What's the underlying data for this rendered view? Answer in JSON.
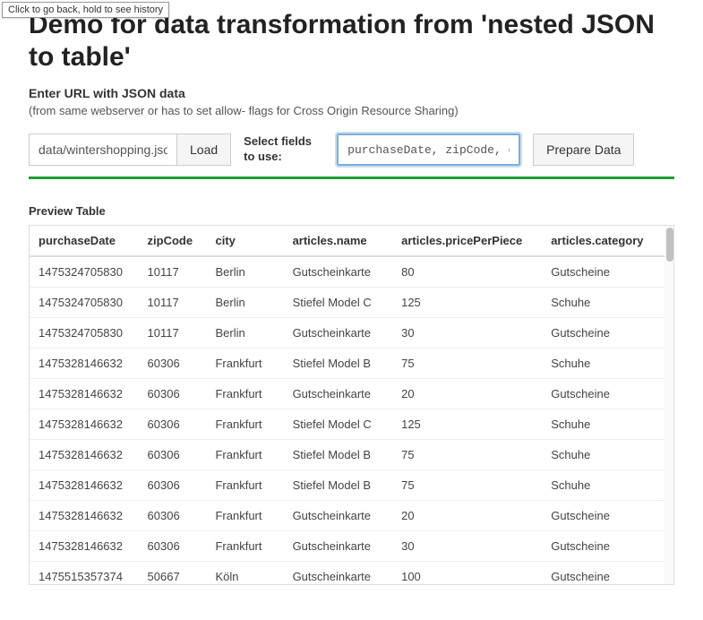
{
  "tooltip_text": "Click to go back, hold to see history",
  "page_title": "Demo for data transformation from 'nested JSON to table'",
  "url_section": {
    "label": "Enter URL with JSON data",
    "hint": "(from same webserver or has to set allow- flags for Cross Origin Resource Sharing)"
  },
  "controls": {
    "url_value": "data/wintershopping.json",
    "load_label": "Load",
    "select_fields_label": "Select fields to use:",
    "fields_value": "purchaseDate, zipCode, city",
    "prepare_label": "Prepare Data"
  },
  "preview": {
    "label": "Preview Table",
    "columns": [
      "purchaseDate",
      "zipCode",
      "city",
      "articles.name",
      "articles.pricePerPiece",
      "articles.category"
    ],
    "rows": [
      [
        "1475324705830",
        "10117",
        "Berlin",
        "Gutscheinkarte",
        "80",
        "Gutscheine"
      ],
      [
        "1475324705830",
        "10117",
        "Berlin",
        "Stiefel Model C",
        "125",
        "Schuhe"
      ],
      [
        "1475324705830",
        "10117",
        "Berlin",
        "Gutscheinkarte",
        "30",
        "Gutscheine"
      ],
      [
        "1475328146632",
        "60306",
        "Frankfurt",
        "Stiefel Model B",
        "75",
        "Schuhe"
      ],
      [
        "1475328146632",
        "60306",
        "Frankfurt",
        "Gutscheinkarte",
        "20",
        "Gutscheine"
      ],
      [
        "1475328146632",
        "60306",
        "Frankfurt",
        "Stiefel Model C",
        "125",
        "Schuhe"
      ],
      [
        "1475328146632",
        "60306",
        "Frankfurt",
        "Stiefel Model B",
        "75",
        "Schuhe"
      ],
      [
        "1475328146632",
        "60306",
        "Frankfurt",
        "Stiefel Model B",
        "75",
        "Schuhe"
      ],
      [
        "1475328146632",
        "60306",
        "Frankfurt",
        "Gutscheinkarte",
        "20",
        "Gutscheine"
      ],
      [
        "1475328146632",
        "60306",
        "Frankfurt",
        "Gutscheinkarte",
        "30",
        "Gutscheine"
      ],
      [
        "1475515357374",
        "50667",
        "Köln",
        "Gutscheinkarte",
        "100",
        "Gutscheine"
      ],
      [
        "",
        "",
        "",
        "",
        "",
        ""
      ]
    ]
  }
}
